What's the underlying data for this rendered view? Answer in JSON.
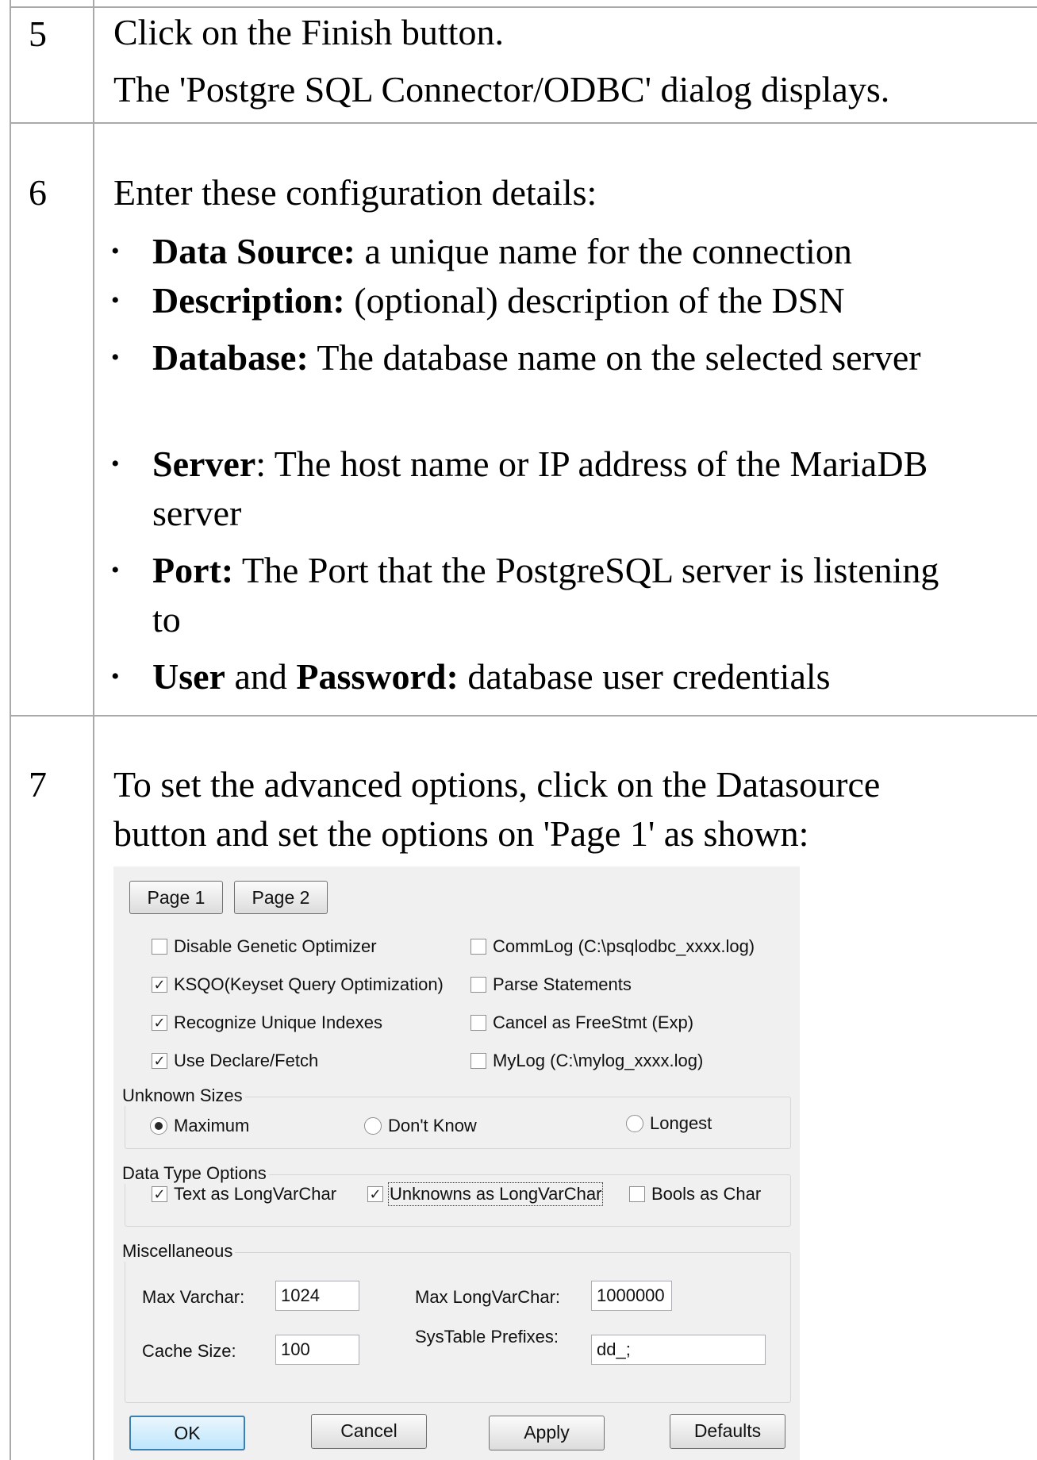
{
  "steps": [
    {
      "number": "5",
      "lines": [
        "Click on the Finish button.",
        "The 'Postgre SQL Connector/ODBC' dialog displays."
      ]
    },
    {
      "number": "6",
      "intro": "Enter these configuration details:",
      "bullets": [
        {
          "bold": "Data Source:",
          "text": " a unique name for the connection"
        },
        {
          "bold": "Description:",
          "text": " (optional) description of the DSN"
        },
        {
          "bold": "Database:",
          "text": " The database name on the selected server"
        },
        {
          "bold": "Server",
          "text": ": The host name or IP address of the MariaDB server"
        },
        {
          "bold": "Port:",
          "text": " The Port that the PostgreSQL server is listening to"
        },
        {
          "bold": "User",
          "mid": " and ",
          "bold2": "Password:",
          "text": " database user credentials"
        }
      ]
    },
    {
      "number": "7",
      "lines": [
        "To set the advanced options, click on the Datasource",
        "button and set the options on 'Page 1' as shown:"
      ]
    }
  ],
  "dialog": {
    "tabs": [
      "Page 1",
      "Page 2"
    ],
    "checkboxes_left": [
      {
        "label": "Disable Genetic Optimizer",
        "checked": false
      },
      {
        "label": "KSQO(Keyset Query Optimization)",
        "checked": true
      },
      {
        "label": "Recognize Unique Indexes",
        "checked": true
      },
      {
        "label": "Use Declare/Fetch",
        "checked": true
      }
    ],
    "checkboxes_right": [
      {
        "label": "CommLog (C:\\psqlodbc_xxxx.log)",
        "checked": false
      },
      {
        "label": "Parse Statements",
        "checked": false
      },
      {
        "label": "Cancel as FreeStmt (Exp)",
        "checked": false
      },
      {
        "label": "MyLog (C:\\mylog_xxxx.log)",
        "checked": false
      }
    ],
    "unknown_sizes": {
      "title": "Unknown Sizes",
      "options": [
        "Maximum",
        "Don't Know",
        "Longest"
      ],
      "selected": "Maximum"
    },
    "data_type_options": {
      "title": "Data Type Options",
      "items": [
        {
          "label": "Text as LongVarChar",
          "checked": true
        },
        {
          "label": "Unknowns as LongVarChar",
          "checked": true
        },
        {
          "label": "Bools as Char",
          "checked": false
        }
      ]
    },
    "misc": {
      "title": "Miscellaneous",
      "max_varchar_label": "Max Varchar:",
      "max_varchar_value": "1024",
      "max_longvarchar_label": "Max LongVarChar:",
      "max_longvarchar_value": "1000000",
      "cache_size_label": "Cache Size:",
      "cache_size_value": "100",
      "systable_label": "SysTable Prefixes:",
      "systable_value": "dd_;"
    },
    "buttons": {
      "ok": "OK",
      "cancel": "Cancel",
      "apply": "Apply",
      "defaults": "Defaults"
    }
  }
}
